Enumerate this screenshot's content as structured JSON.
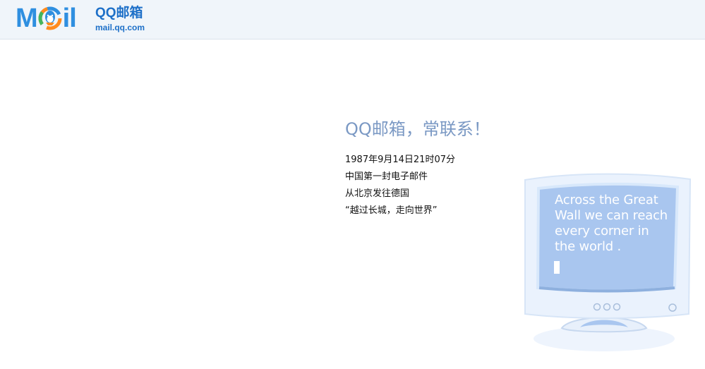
{
  "header": {
    "logo": {
      "wordmark": "Mail",
      "brand": "QQ邮箱",
      "domain": "mail.qq.com"
    }
  },
  "main": {
    "slogan": "QQ邮箱，常联系！",
    "story": [
      "1987年9月14日21时07分",
      "中国第一封电子邮件",
      "从北京发往德国",
      "“越过长城，走向世界”"
    ]
  },
  "monitor": {
    "screen_text": "Across the Great Wall we can reach every corner in the world ."
  },
  "colors": {
    "header_background": "#f0f5fa",
    "logo_blue": "#2f8fe0",
    "slogan_blue": "#7b99c4",
    "monitor_screen": "#a9c6ef"
  },
  "icons": {
    "logo_mark": "qq-mail-logo-icon",
    "monitor": "monitor-icon"
  }
}
